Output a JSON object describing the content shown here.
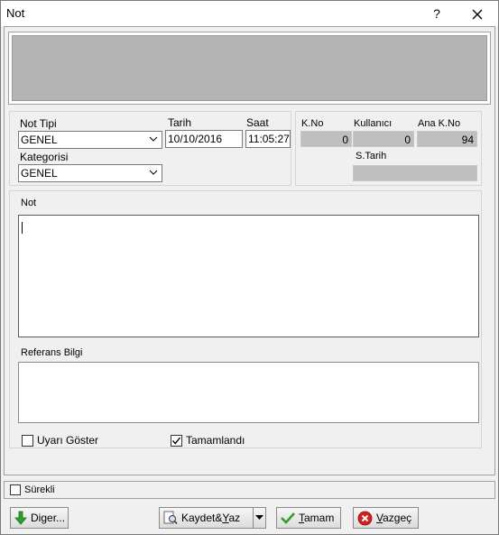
{
  "window": {
    "title": "Not",
    "help_label": "?"
  },
  "form": {
    "not_tipi_label": "Not Tipi",
    "not_tipi_value": "GENEL",
    "tarih_label": "Tarih",
    "tarih_value": "10/10/2016",
    "saat_label": "Saat",
    "saat_value": "11:05:27",
    "kategorisi_label": "Kategorisi",
    "kategorisi_value": "GENEL",
    "kno_label": "K.No",
    "kno_value": "0",
    "kullanici_label": "Kullanıcı",
    "kullanici_value": "0",
    "ana_kno_label": "Ana K.No",
    "ana_kno_value": "94",
    "s_tarih_label": "S.Tarih",
    "s_tarih_value": "",
    "not_label": "Not",
    "not_value": "",
    "referans_label": "Referans Bilgi",
    "referans_value": ""
  },
  "checks": {
    "uyari_label": "Uyarı Göster",
    "uyari_checked": false,
    "tamamlandi_label": "Tamamlandı",
    "tamamlandi_checked": true,
    "surekli_label": "Sürekli",
    "surekli_checked": false
  },
  "buttons": {
    "diger_pre": "Di",
    "diger_u": "g",
    "diger_post": "er...",
    "kaydet_pre": "Kaydet&",
    "kaydet_u": "Y",
    "kaydet_post": "az",
    "tamam_u": "T",
    "tamam_post": "amam",
    "vazgec_u": "V",
    "vazgec_post": "azgeç"
  },
  "colors": {
    "accent_green": "#2e9e2e",
    "cancel_red": "#d42020",
    "readonly_gray": "#bfbfbf"
  }
}
